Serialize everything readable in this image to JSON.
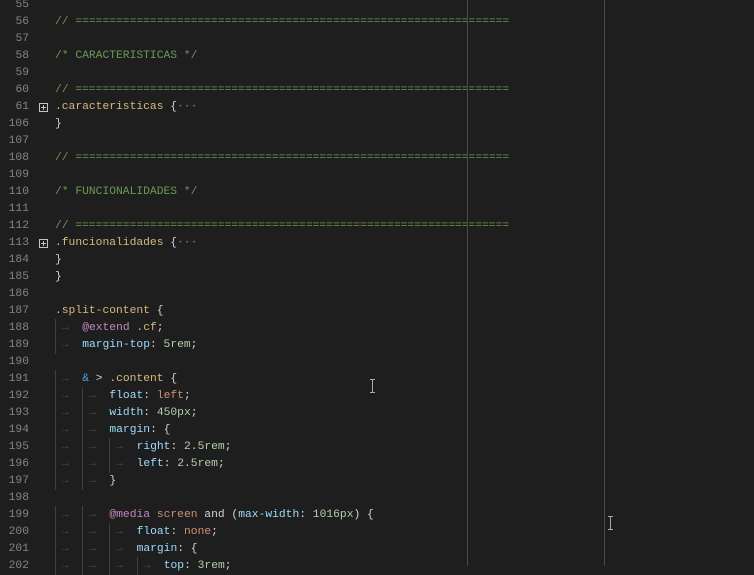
{
  "colors": {
    "background": "#1e1e1e",
    "comment": "#6a9955",
    "selector": "#d7ba7d",
    "property": "#9cdcfe",
    "value": "#ce9178",
    "number": "#b5cea8",
    "at_rule": "#c586c0",
    "ampersand": "#569cd6"
  },
  "lines": [
    {
      "n": "55",
      "indent": 0,
      "tokens": []
    },
    {
      "n": "56",
      "indent": 0,
      "tokens": [
        [
          "comment",
          "// ================================================================"
        ]
      ]
    },
    {
      "n": "57",
      "indent": 0,
      "tokens": []
    },
    {
      "n": "58",
      "indent": 0,
      "tokens": [
        [
          "comment",
          "/* CARACTERISTICAS */"
        ]
      ]
    },
    {
      "n": "59",
      "indent": 0,
      "tokens": []
    },
    {
      "n": "60",
      "indent": 0,
      "tokens": [
        [
          "comment",
          "// ================================================================"
        ]
      ]
    },
    {
      "n": "61",
      "indent": 0,
      "folded": true,
      "tokens": [
        [
          "selector",
          ".caracteristicas"
        ],
        [
          "punct",
          " {"
        ],
        [
          "dots",
          "···"
        ]
      ]
    },
    {
      "n": "106",
      "indent": 0,
      "tokens": [
        [
          "punct",
          "}"
        ]
      ]
    },
    {
      "n": "107",
      "indent": 0,
      "tokens": []
    },
    {
      "n": "108",
      "indent": 0,
      "tokens": [
        [
          "comment",
          "// ================================================================"
        ]
      ]
    },
    {
      "n": "109",
      "indent": 0,
      "tokens": []
    },
    {
      "n": "110",
      "indent": 0,
      "tokens": [
        [
          "comment",
          "/* FUNCIONALIDADES */"
        ]
      ]
    },
    {
      "n": "111",
      "indent": 0,
      "tokens": []
    },
    {
      "n": "112",
      "indent": 0,
      "tokens": [
        [
          "comment",
          "// ================================================================"
        ]
      ]
    },
    {
      "n": "113",
      "indent": 0,
      "folded": true,
      "tokens": [
        [
          "selector",
          ".funcionalidades"
        ],
        [
          "punct",
          " {"
        ],
        [
          "dots",
          "···"
        ]
      ]
    },
    {
      "n": "184",
      "indent": 0,
      "tokens": [
        [
          "punct",
          "}"
        ]
      ]
    },
    {
      "n": "185",
      "indent": 0,
      "tokens": [
        [
          "punct",
          "}"
        ]
      ]
    },
    {
      "n": "186",
      "indent": 0,
      "tokens": []
    },
    {
      "n": "187",
      "indent": 0,
      "tokens": [
        [
          "selector",
          ".split-content"
        ],
        [
          "punct",
          " {"
        ]
      ]
    },
    {
      "n": "188",
      "indent": 1,
      "tokens": [
        [
          "at",
          "@extend"
        ],
        [
          "selector",
          " .cf"
        ],
        [
          "punct",
          ";"
        ]
      ]
    },
    {
      "n": "189",
      "indent": 1,
      "tokens": [
        [
          "prop",
          "margin-top"
        ],
        [
          "punct",
          ": "
        ],
        [
          "num",
          "5rem"
        ],
        [
          "punct",
          ";"
        ]
      ]
    },
    {
      "n": "190",
      "indent": 0,
      "tokens": []
    },
    {
      "n": "191",
      "indent": 1,
      "tokens": [
        [
          "amp",
          "&"
        ],
        [
          "punct",
          " > "
        ],
        [
          "selector",
          ".content"
        ],
        [
          "punct",
          " {"
        ]
      ]
    },
    {
      "n": "192",
      "indent": 2,
      "tokens": [
        [
          "prop",
          "float"
        ],
        [
          "punct",
          ": "
        ],
        [
          "value",
          "left"
        ],
        [
          "punct",
          ";"
        ]
      ]
    },
    {
      "n": "193",
      "indent": 2,
      "tokens": [
        [
          "prop",
          "width"
        ],
        [
          "punct",
          ": "
        ],
        [
          "num",
          "450px"
        ],
        [
          "punct",
          ";"
        ]
      ]
    },
    {
      "n": "194",
      "indent": 2,
      "tokens": [
        [
          "prop",
          "margin"
        ],
        [
          "punct",
          ": {"
        ]
      ]
    },
    {
      "n": "195",
      "indent": 3,
      "tokens": [
        [
          "prop",
          "right"
        ],
        [
          "punct",
          ": "
        ],
        [
          "num",
          "2.5rem"
        ],
        [
          "punct",
          ";"
        ]
      ]
    },
    {
      "n": "196",
      "indent": 3,
      "tokens": [
        [
          "prop",
          "left"
        ],
        [
          "punct",
          ": "
        ],
        [
          "num",
          "2.5rem"
        ],
        [
          "punct",
          ";"
        ]
      ]
    },
    {
      "n": "197",
      "indent": 2,
      "tokens": [
        [
          "punct",
          "}"
        ]
      ]
    },
    {
      "n": "198",
      "indent": 0,
      "tokens": []
    },
    {
      "n": "199",
      "indent": 2,
      "tokens": [
        [
          "at",
          "@media"
        ],
        [
          "value",
          " screen"
        ],
        [
          "punct",
          " and ("
        ],
        [
          "prop",
          "max-width"
        ],
        [
          "punct",
          ": "
        ],
        [
          "num",
          "1016px"
        ],
        [
          "punct",
          ") {"
        ]
      ]
    },
    {
      "n": "200",
      "indent": 3,
      "tokens": [
        [
          "prop",
          "float"
        ],
        [
          "punct",
          ": "
        ],
        [
          "value",
          "none"
        ],
        [
          "punct",
          ";"
        ]
      ]
    },
    {
      "n": "201",
      "indent": 3,
      "tokens": [
        [
          "prop",
          "margin"
        ],
        [
          "punct",
          ": {"
        ]
      ]
    },
    {
      "n": "202",
      "indent": 4,
      "tokens": [
        [
          "prop",
          "top"
        ],
        [
          "punct",
          ": "
        ],
        [
          "num",
          "3rem"
        ],
        [
          "punct",
          ";"
        ]
      ]
    }
  ]
}
